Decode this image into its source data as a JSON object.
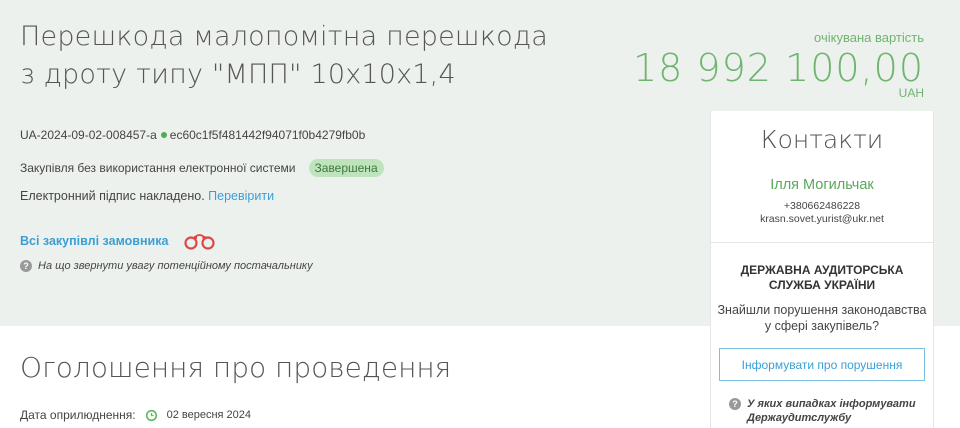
{
  "tender": {
    "title_line1": "Перешкода малопомітна перешкода",
    "title_line2": "з дроту типу \"МПП\" 10х10х1,4",
    "price_label": "очікувана вартість",
    "price_value": "18 992 100,00",
    "currency": "UAH",
    "tender_id": "UA-2024-09-02-008457-a",
    "hash": "ec60c1f5f481442f94071f0b4279fb0b",
    "procedure_type": "Закупівля без використання електронної системи",
    "status": "Завершена",
    "signature_text": "Електронний підпис накладено.",
    "verify_link": "Перевірити",
    "all_purchases_link": "Всі закупівлі замовника",
    "supplier_hint": "На що звернути увагу потенційному постачальнику"
  },
  "contacts": {
    "title": "Контакти",
    "name": "Ілля Могильчак",
    "phone": "+380662486228",
    "email": "krasn.sovet.yurist@ukr.net"
  },
  "audit": {
    "title": "ДЕРЖАВНА АУДИТОРСЬКА СЛУЖБА УКРАЇНИ",
    "text": "Знайшли порушення законодавства у сфері закупівель?",
    "button": "Інформувати про порушення",
    "hint": "У яких випадках інформувати Держаудитслужбу"
  },
  "announcement": {
    "title": "Оголошення про проведення",
    "pub_label": "Дата оприлюднення:",
    "pub_date": "02 вересня 2024"
  },
  "colors": {
    "accent_green": "#6fb46f",
    "link_blue": "#3a9fd6",
    "band_bg": "#edf1ee"
  },
  "icons": {
    "handcuffs": "handcuffs-icon",
    "question": "question-icon",
    "clock": "clock-icon"
  }
}
